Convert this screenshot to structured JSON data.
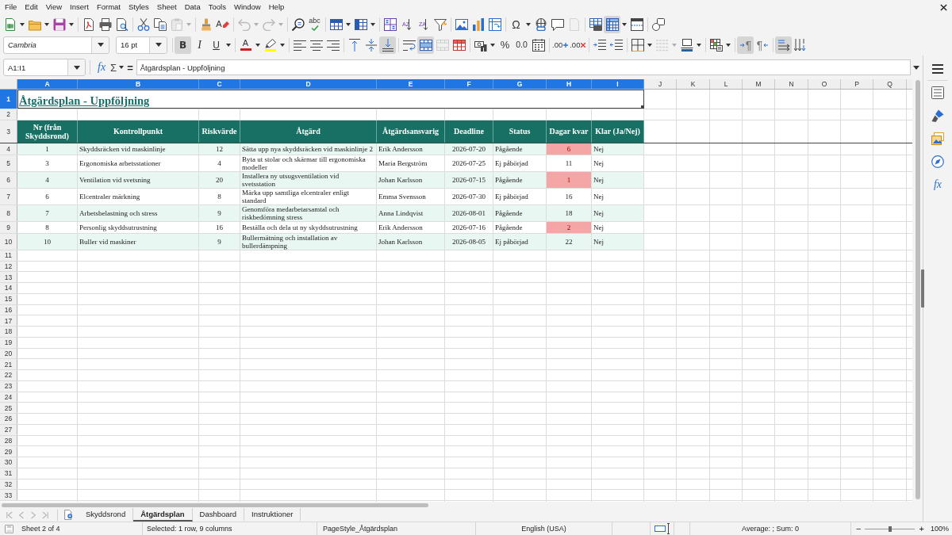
{
  "menu_bar": [
    "File",
    "Edit",
    "View",
    "Insert",
    "Format",
    "Styles",
    "Sheet",
    "Data",
    "Tools",
    "Window",
    "Help"
  ],
  "standard_toolbar": [
    {
      "kind": "new",
      "pressed": false,
      "disabled": false,
      "dropdown": true
    },
    {
      "kind": "open",
      "pressed": false,
      "disabled": false,
      "dropdown": true
    },
    {
      "kind": "save",
      "pressed": false,
      "disabled": false,
      "dropdown": true
    },
    {
      "kind": "separator"
    },
    {
      "kind": "pdf",
      "pressed": false,
      "disabled": false
    },
    {
      "kind": "print",
      "pressed": false,
      "disabled": false
    },
    {
      "kind": "preview",
      "pressed": false,
      "disabled": false
    },
    {
      "kind": "separator"
    },
    {
      "kind": "cut",
      "pressed": false,
      "disabled": false
    },
    {
      "kind": "copy",
      "pressed": false,
      "disabled": false
    },
    {
      "kind": "paste",
      "pressed": false,
      "disabled": true,
      "dropdown": true
    },
    {
      "kind": "separator"
    },
    {
      "kind": "clone",
      "pressed": false,
      "disabled": false
    },
    {
      "kind": "clear",
      "pressed": false,
      "disabled": false,
      "glyph": "A"
    },
    {
      "kind": "separator"
    },
    {
      "kind": "undo",
      "pressed": false,
      "disabled": true,
      "dropdown": true
    },
    {
      "kind": "redo",
      "pressed": false,
      "disabled": true,
      "dropdown": true
    },
    {
      "kind": "separator"
    },
    {
      "kind": "find",
      "pressed": false,
      "disabled": false
    },
    {
      "kind": "spelling",
      "pressed": false,
      "disabled": false,
      "glyph": "abc"
    },
    {
      "kind": "separator"
    },
    {
      "kind": "rows",
      "pressed": false,
      "disabled": false,
      "dropdown": true
    },
    {
      "kind": "columns",
      "pressed": false,
      "disabled": false,
      "dropdown": true
    },
    {
      "kind": "separator"
    },
    {
      "kind": "sort",
      "pressed": false,
      "disabled": false
    },
    {
      "kind": "sort_ascending",
      "pressed": false,
      "disabled": false,
      "glyph": "AZ"
    },
    {
      "kind": "sort_descending",
      "pressed": false,
      "disabled": false,
      "glyph": "ZA"
    },
    {
      "kind": "autofilter",
      "pressed": false,
      "disabled": false
    },
    {
      "kind": "separator"
    },
    {
      "kind": "image",
      "pressed": false,
      "disabled": false
    },
    {
      "kind": "chart",
      "pressed": false,
      "disabled": false
    },
    {
      "kind": "pivot",
      "pressed": false,
      "disabled": false
    },
    {
      "kind": "separator"
    },
    {
      "kind": "special_character",
      "pressed": false,
      "disabled": false,
      "glyph": "Ω",
      "dropdown": true
    },
    {
      "kind": "hyperlink",
      "pressed": false,
      "disabled": false
    },
    {
      "kind": "comment",
      "pressed": false,
      "disabled": false
    },
    {
      "kind": "header_footer",
      "pressed": false,
      "disabled": true
    },
    {
      "kind": "separator"
    },
    {
      "kind": "print_area",
      "pressed": false,
      "disabled": false
    },
    {
      "kind": "freeze",
      "pressed": true,
      "disabled": false,
      "dropdown": true
    },
    {
      "kind": "split",
      "pressed": false,
      "disabled": false
    },
    {
      "kind": "separator"
    },
    {
      "kind": "draw",
      "pressed": false,
      "disabled": false
    }
  ],
  "formatting_toolbar": {
    "font_name": "Cambria",
    "font_size": "16 pt",
    "buttons": [
      {
        "kind": "separator"
      },
      {
        "kind": "bold",
        "pressed": true,
        "disabled": false,
        "glyph": "B"
      },
      {
        "kind": "italic",
        "pressed": false,
        "disabled": false,
        "glyph": "I"
      },
      {
        "kind": "underline",
        "pressed": false,
        "disabled": false,
        "glyph": "U",
        "dropdown": true
      },
      {
        "kind": "separator"
      },
      {
        "kind": "font_color",
        "pressed": false,
        "disabled": false,
        "glyph": "A",
        "color": "#c9211e",
        "dropdown": true
      },
      {
        "kind": "highlight",
        "pressed": false,
        "disabled": false,
        "color": "#ffff00",
        "dropdown": true
      },
      {
        "kind": "separator"
      },
      {
        "kind": "align_left",
        "pressed": false,
        "disabled": false
      },
      {
        "kind": "align_center",
        "pressed": false,
        "disabled": false
      },
      {
        "kind": "align_right",
        "pressed": false,
        "disabled": false
      },
      {
        "kind": "separator"
      },
      {
        "kind": "align_top",
        "pressed": false,
        "disabled": false
      },
      {
        "kind": "align_middle",
        "pressed": false,
        "disabled": false
      },
      {
        "kind": "align_bottom",
        "pressed": true,
        "disabled": false
      },
      {
        "kind": "separator"
      },
      {
        "kind": "wrap",
        "pressed": false,
        "disabled": false
      },
      {
        "kind": "merge_center",
        "pressed": true,
        "disabled": false
      },
      {
        "kind": "merge",
        "pressed": false,
        "disabled": true
      },
      {
        "kind": "unmerge",
        "pressed": false,
        "disabled": false
      },
      {
        "kind": "separator"
      },
      {
        "kind": "currency",
        "pressed": false,
        "disabled": false,
        "dropdown": true
      },
      {
        "kind": "percent",
        "pressed": false,
        "disabled": false,
        "glyph": "%"
      },
      {
        "kind": "number",
        "pressed": false,
        "disabled": false,
        "glyph": "0.0"
      },
      {
        "kind": "date",
        "pressed": false,
        "disabled": false
      },
      {
        "kind": "separator"
      },
      {
        "kind": "add_decimal",
        "pressed": false,
        "disabled": false,
        "glyph": ".00"
      },
      {
        "kind": "delete_decimal",
        "pressed": false,
        "disabled": false,
        "glyph": ".00"
      },
      {
        "kind": "separator"
      },
      {
        "kind": "indent_more",
        "pressed": false,
        "disabled": false
      },
      {
        "kind": "indent_less",
        "pressed": false,
        "disabled": false
      },
      {
        "kind": "separator"
      },
      {
        "kind": "borders",
        "pressed": false,
        "disabled": false,
        "dropdown": true
      },
      {
        "kind": "border_style",
        "pressed": false,
        "disabled": true,
        "dropdown": true
      },
      {
        "kind": "border_color",
        "pressed": false,
        "disabled": false,
        "color": "#2a6099",
        "dropdown": true
      },
      {
        "kind": "separator"
      },
      {
        "kind": "conditional",
        "pressed": false,
        "disabled": false,
        "dropdown": true
      },
      {
        "kind": "separator"
      },
      {
        "kind": "ltr",
        "pressed": true,
        "disabled": false,
        "glyph": "¶"
      },
      {
        "kind": "rtl",
        "pressed": false,
        "disabled": false,
        "glyph": "¶"
      },
      {
        "kind": "separator"
      },
      {
        "kind": "text_lr",
        "pressed": true,
        "disabled": false
      },
      {
        "kind": "text_tb",
        "pressed": false,
        "disabled": false
      }
    ]
  },
  "formula_bar": {
    "name_box": "A1:I1",
    "function_wizard": "fx",
    "sum": "Σ",
    "formula_sign": "=",
    "formula": "Åtgärdsplan - Uppföljning"
  },
  "sidebar": {
    "tabs": [
      {
        "kind": "menu"
      },
      {
        "kind": "properties"
      },
      {
        "kind": "styles"
      },
      {
        "kind": "gallery"
      },
      {
        "kind": "navigator"
      },
      {
        "kind": "functions",
        "glyph": "fx"
      }
    ]
  },
  "sheet": {
    "columns": [
      {
        "label": "A",
        "selected": true
      },
      {
        "label": "B",
        "selected": true
      },
      {
        "label": "C",
        "selected": true
      },
      {
        "label": "D",
        "selected": true
      },
      {
        "label": "E",
        "selected": true
      },
      {
        "label": "F",
        "selected": true
      },
      {
        "label": "G",
        "selected": true
      },
      {
        "label": "H",
        "selected": true
      },
      {
        "label": "I",
        "selected": true
      },
      {
        "label": "J",
        "selected": false
      },
      {
        "label": "K",
        "selected": false
      },
      {
        "label": "L",
        "selected": false
      },
      {
        "label": "M",
        "selected": false
      },
      {
        "label": "N",
        "selected": false
      },
      {
        "label": "O",
        "selected": false
      },
      {
        "label": "P",
        "selected": false
      },
      {
        "label": "Q",
        "selected": false
      }
    ],
    "rows": [
      {
        "number": "1",
        "selected": true,
        "kind": "title",
        "cursor": true,
        "text": "Åtgärdsplan - Uppföljning"
      },
      {
        "number": "2",
        "selected": false,
        "kind": "blank"
      },
      {
        "number": "3",
        "selected": false,
        "kind": "header",
        "cells": [
          "Nr (från Skyddsrond)",
          "Kontrollpunkt",
          "Riskvärde",
          "Åtgärd",
          "Åtgärdsansvarig",
          "Deadline",
          "Status",
          "Dagar kvar",
          "Klar (Ja/Nej)"
        ]
      },
      {
        "number": "4",
        "selected": false,
        "kind": "data",
        "shaded": true,
        "days_alert": true,
        "cells": [
          "1",
          "Skyddsräcken vid maskinlinje",
          "12",
          "Sätta upp nya skyddsräcken vid maskinlinje 2",
          "Erik Andersson",
          "2026-07-20",
          "Pågående",
          "6",
          "Nej"
        ]
      },
      {
        "number": "5",
        "selected": false,
        "kind": "data",
        "shaded": false,
        "days_alert": false,
        "cells": [
          "3",
          "Ergonomiska arbetsstationer",
          "4",
          "Byta ut stolar och skärmar till ergonomiska modeller",
          "Maria Bergström",
          "2026-07-25",
          "Ej påbörjad",
          "11",
          "Nej"
        ]
      },
      {
        "number": "6",
        "selected": false,
        "kind": "data",
        "shaded": true,
        "days_alert": true,
        "cells": [
          "4",
          "Ventilation vid svetsning",
          "20",
          "Installera ny utsugsventilation vid svetsstation",
          "Johan Karlsson",
          "2026-07-15",
          "Pågående",
          "1",
          "Nej"
        ]
      },
      {
        "number": "7",
        "selected": false,
        "kind": "data",
        "shaded": false,
        "days_alert": false,
        "cells": [
          "6",
          "Elcentraler märkning",
          "8",
          "Märka upp samtliga elcentraler enligt standard",
          "Emma Svensson",
          "2026-07-30",
          "Ej påbörjad",
          "16",
          "Nej"
        ]
      },
      {
        "number": "8",
        "selected": false,
        "kind": "data",
        "shaded": true,
        "days_alert": false,
        "cells": [
          "7",
          "Arbetsbelastning och stress",
          "9",
          "Genomföra medarbetarsamtal och riskbedömning stress",
          "Anna Lindqvist",
          "2026-08-01",
          "Pågående",
          "18",
          "Nej"
        ]
      },
      {
        "number": "9",
        "selected": false,
        "kind": "data",
        "shaded": false,
        "days_alert": true,
        "cells": [
          "8",
          "Personlig skyddsutrustning",
          "16",
          "Beställa och dela ut ny skyddsutrustning",
          "Erik Andersson",
          "2026-07-16",
          "Pågående",
          "2",
          "Nej"
        ]
      },
      {
        "number": "10",
        "selected": false,
        "kind": "data",
        "shaded": true,
        "days_alert": false,
        "cells": [
          "10",
          "Buller vid maskiner",
          "9",
          "Bullermätning och installation av bullerdämpning",
          "Johan Karlsson",
          "2026-08-05",
          "Ej påbörjad",
          "22",
          "Nej"
        ]
      },
      {
        "number": "11",
        "selected": false,
        "kind": "blank"
      },
      {
        "number": "12",
        "selected": false,
        "kind": "blank"
      },
      {
        "number": "13",
        "selected": false,
        "kind": "blank"
      },
      {
        "number": "14",
        "selected": false,
        "kind": "blank"
      },
      {
        "number": "15",
        "selected": false,
        "kind": "blank"
      },
      {
        "number": "16",
        "selected": false,
        "kind": "blank"
      },
      {
        "number": "17",
        "selected": false,
        "kind": "blank"
      },
      {
        "number": "18",
        "selected": false,
        "kind": "blank"
      },
      {
        "number": "19",
        "selected": false,
        "kind": "blank"
      },
      {
        "number": "20",
        "selected": false,
        "kind": "blank"
      },
      {
        "number": "21",
        "selected": false,
        "kind": "blank"
      },
      {
        "number": "22",
        "selected": false,
        "kind": "blank"
      },
      {
        "number": "23",
        "selected": false,
        "kind": "blank"
      },
      {
        "number": "24",
        "selected": false,
        "kind": "blank"
      },
      {
        "number": "25",
        "selected": false,
        "kind": "blank"
      },
      {
        "number": "26",
        "selected": false,
        "kind": "blank"
      },
      {
        "number": "27",
        "selected": false,
        "kind": "blank"
      },
      {
        "number": "28",
        "selected": false,
        "kind": "blank"
      },
      {
        "number": "29",
        "selected": false,
        "kind": "blank"
      },
      {
        "number": "30",
        "selected": false,
        "kind": "blank"
      },
      {
        "number": "31",
        "selected": false,
        "kind": "blank"
      },
      {
        "number": "32",
        "selected": false,
        "kind": "blank"
      },
      {
        "number": "33",
        "selected": false,
        "kind": "blank"
      }
    ]
  },
  "sheet_tabs": {
    "navigation_disabled": true,
    "tabs": [
      {
        "label": "Skyddsrond",
        "selected": false
      },
      {
        "label": "Åtgärdsplan",
        "selected": true
      },
      {
        "label": "Dashboard",
        "selected": false
      },
      {
        "label": "Instruktioner",
        "selected": false
      }
    ]
  },
  "status_bar": {
    "sheet_position": "Sheet 2 of 4",
    "selection": "Selected: 1 row, 9 columns",
    "page_style": "PageStyle_Åtgärdsplan",
    "language": "English (USA)",
    "summary": "Average: ; Sum: 0",
    "zoom": {
      "out": "−",
      "in": "+",
      "level": 0.5,
      "reading": "100%"
    }
  }
}
